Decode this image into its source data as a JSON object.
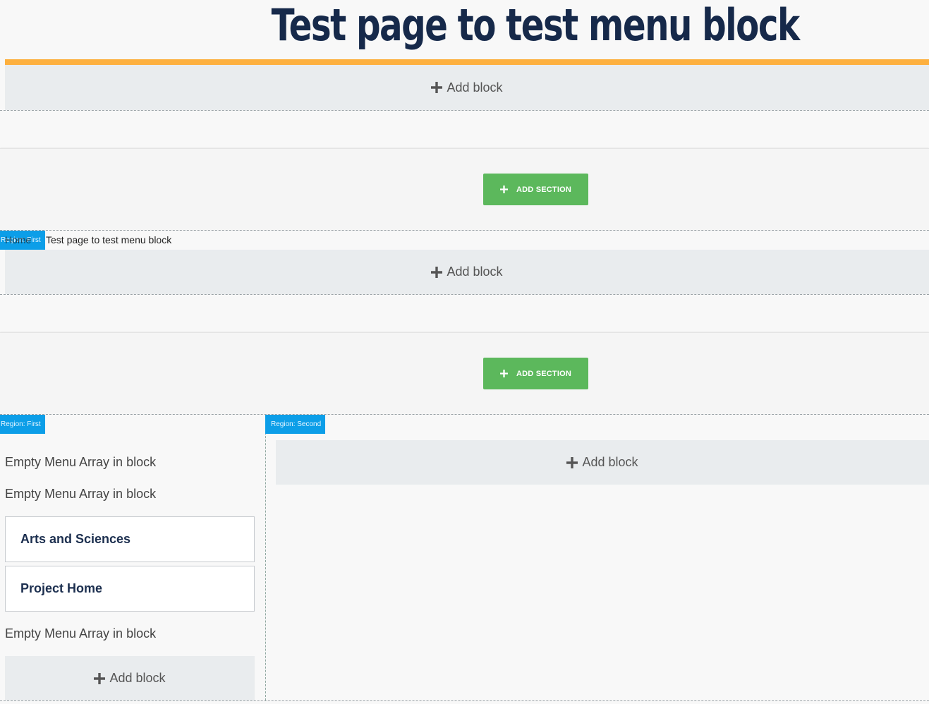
{
  "page": {
    "title": "Test page to test menu block"
  },
  "header_section": {
    "add_block_label": "Add block"
  },
  "add_section_buttons": {
    "first_label": "ADD SECTION",
    "second_label": "ADD SECTION"
  },
  "breadcrumb_section": {
    "region_tag": "Region: First",
    "home_label": "Home",
    "current_label": "Test page to test menu block",
    "add_block_label": "Add block"
  },
  "two_column_section": {
    "first_region": {
      "region_tag": "Region: First",
      "empty_messages": [
        "Empty Menu Array in block",
        "Empty Menu Array in block",
        "Empty Menu Array in block"
      ],
      "menu_items": [
        "Arts and Sciences",
        "Project Home"
      ],
      "add_block_label": "Add block"
    },
    "second_region": {
      "region_tag": "Region: Second",
      "add_block_label": "Add block"
    }
  },
  "icons": {
    "add_block": "plus-icon",
    "add_section": "plus-icon"
  },
  "colors": {
    "title": "#16294a",
    "accent_bar": "#fdb03f",
    "add_section_bg": "#5cb85c",
    "region_tag_bg": "#0c9ee8",
    "add_block_bg": "#e9ecee"
  }
}
